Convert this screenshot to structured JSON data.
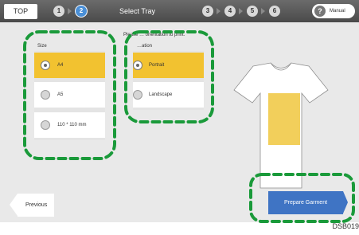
{
  "topbar": {
    "top_label": "TOP",
    "steps_before": [
      "1",
      "2"
    ],
    "title": "Select Tray",
    "steps_after": [
      "3",
      "4",
      "5",
      "6"
    ],
    "manual_label": "Manual",
    "manual_icon": "?"
  },
  "instruction": "Please … orientation to print.",
  "size_section": {
    "label": "Size",
    "options": [
      {
        "label": "A4",
        "selected": true
      },
      {
        "label": "A5",
        "selected": false
      },
      {
        "label": "110 * 110 mm",
        "selected": false
      }
    ]
  },
  "orientation_section": {
    "label": "…ation",
    "options": [
      {
        "label": "Portrait",
        "selected": true
      },
      {
        "label": "Landscape",
        "selected": false
      }
    ]
  },
  "preview": {
    "shirt_color": "#ffffff",
    "print_area_color": "#f2cf5b"
  },
  "buttons": {
    "previous": "Previous",
    "prepare": "Prepare Garment"
  },
  "figure_code": "DSB019",
  "colors": {
    "accent_selected": "#f2c230",
    "primary_button": "#3f74c4",
    "highlight_dash": "#1a9a3a"
  }
}
